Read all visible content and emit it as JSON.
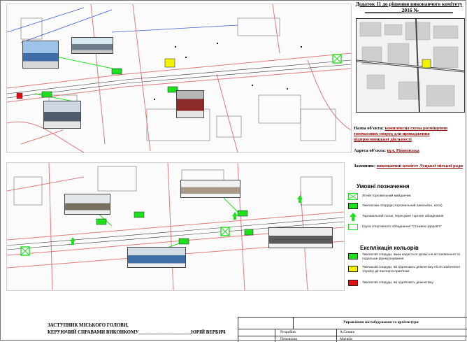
{
  "header": {
    "line1": "Додаток 11 до рішення виконавчого комітету",
    "line2": "______________2016 №_____________"
  },
  "info": {
    "object_label": "Назва об'єкта:",
    "object_value": "комплексна схема розміщення тимчасових споруд для провадження підприємницької діяльності",
    "address_label": "Адреса об'єкта:",
    "address_value": "вул. Рівненська",
    "customer_label": "Замовник:",
    "customer_value": "виконавчий комітет Луцької міської ради"
  },
  "legend": {
    "title": "Умовні позначення",
    "items": [
      {
        "label": "Літній торговельний майданчик",
        "icon": "crossed-square"
      },
      {
        "label": "Тимчасова споруда (торговельний павільйон, кіоск)",
        "icon": "green-box"
      },
      {
        "label": "Торговельний лоток, пересувне торгове обладнання",
        "icon": "green-arrow"
      },
      {
        "label": "Група спортивного обладнання \"Стежина здоров'я\"",
        "icon": "outline-box"
      }
    ]
  },
  "colors": {
    "title": "Експлікація кольорів",
    "items": [
      {
        "label": "Тимчасові споруди, яким надається дозвіл на встановлення та подальше функціонування",
        "color": "#1ee01e"
      },
      {
        "label": "Тимчасові споруди, які підлягають демонтажу після закінчення терміну дії паспорта прив'язки",
        "color": "#f2f200"
      },
      {
        "label": "Тимчасові споруди, які підлягають демонтажу",
        "color": "#e01010"
      }
    ]
  },
  "signature": {
    "line1": "ЗАСТУПНИК МІСЬКОГО ГОЛОВИ,",
    "line2": "КЕРУЮЧИЙ СПРАВАМИ ВИКОНКОМУ______________________ЮРІЙ ВЕРБИЧ"
  },
  "stamp": {
    "org": "Управління містобудування та архітектури",
    "row1_role": "Розробив",
    "row1_name": "А.Сенюк",
    "row2_role": "Перевірив",
    "row2_name": "Матвіїв"
  },
  "accent": {
    "green": "#1ee01e",
    "yellow": "#f2f200",
    "red": "#e01010",
    "road": "#e07b7b"
  }
}
